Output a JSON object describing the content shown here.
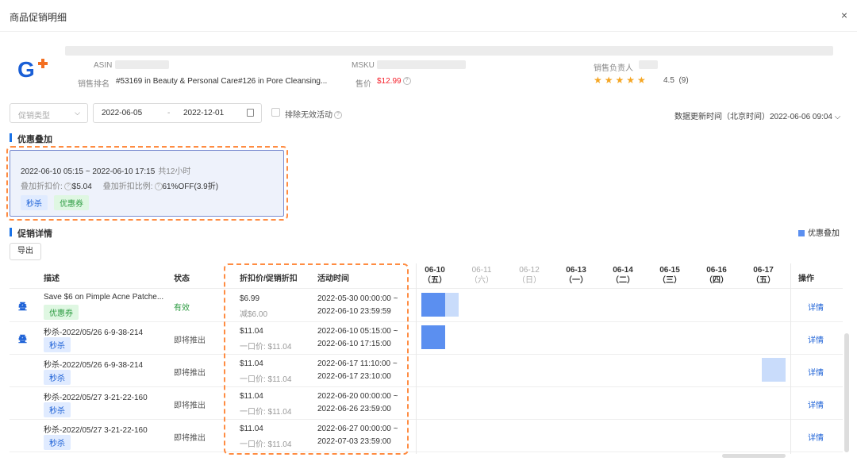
{
  "window": {
    "title": "商品促销明细",
    "close": "×"
  },
  "product": {
    "asin_label": "ASIN",
    "msku_label": "MSKU",
    "owner_label": "销售负责人",
    "rank_label": "销售排名",
    "rank_value": "#53169 in Beauty & Personal Care#126 in Pore Cleansing...",
    "price_label": "售价",
    "price_value": "$12.99",
    "rating_value": "4.5",
    "rating_count": "(9)",
    "stars": "★★★★★",
    "logo_color": "#1a5fd6",
    "logo_accent": "#f36f21"
  },
  "filters": {
    "type_placeholder": "促销类型",
    "date_start": "2022-06-05",
    "date_sep": "-",
    "date_end": "2022-12-01",
    "exclude_label": "排除无效活动",
    "update_text": "数据更新时间（北京时间）2022-06-06 09:04"
  },
  "stack_section": {
    "title": "优惠叠加",
    "time_range": "2022-06-10 05:15 ~ 2022-06-10 17:15",
    "duration": "共12小时",
    "price_label": "叠加折扣价:",
    "price_value": "$5.04",
    "ratio_label": "叠加折扣比例:",
    "ratio_value": "61%OFF(3.9折)",
    "tags": [
      "秒杀",
      "优惠券"
    ]
  },
  "detail_section": {
    "title": "促销详情",
    "legend": "优惠叠加",
    "export_label": "导出",
    "columns": {
      "desc": "描述",
      "status": "状态",
      "price": "折扣价/促销折扣",
      "time": "活动时间",
      "op": "操作"
    },
    "days": [
      {
        "date": "06-10",
        "dow": "（五）"
      },
      {
        "date": "06-11",
        "dow": "（六）"
      },
      {
        "date": "06-12",
        "dow": "（日）"
      },
      {
        "date": "06-13",
        "dow": "（一）"
      },
      {
        "date": "06-14",
        "dow": "（二）"
      },
      {
        "date": "06-15",
        "dow": "（三）"
      },
      {
        "date": "06-16",
        "dow": "（四）"
      },
      {
        "date": "06-17",
        "dow": "（五）"
      }
    ],
    "rows": [
      {
        "flag": "叠",
        "desc": "Save $6 on Pimple Acne Patche...",
        "tag": "优惠券",
        "status": "有效",
        "price": "$6.99",
        "price_sub": "减$6.00",
        "start": "2022-05-30 00:00:00 ~",
        "end": "2022-06-10 23:59:59",
        "op": "详情"
      },
      {
        "flag": "叠",
        "desc": "秒杀-2022/05/26 6-9-38-214",
        "tag": "秒杀",
        "status": "即将推出",
        "price": "$11.04",
        "price_sub": "一口价: $11.04",
        "start": "2022-06-10 05:15:00 ~",
        "end": "2022-06-10 17:15:00",
        "op": "详情"
      },
      {
        "flag": "",
        "desc": "秒杀-2022/05/26 6-9-38-214",
        "tag": "秒杀",
        "status": "即将推出",
        "price": "$11.04",
        "price_sub": "一口价: $11.04",
        "start": "2022-06-17 11:10:00 ~",
        "end": "2022-06-17 23:10:00",
        "op": "详情"
      },
      {
        "flag": "",
        "desc": "秒杀-2022/05/27 3-21-22-160",
        "tag": "秒杀",
        "status": "即将推出",
        "price": "$11.04",
        "price_sub": "一口价: $11.04",
        "start": "2022-06-20 00:00:00 ~",
        "end": "2022-06-26 23:59:00",
        "op": "详情"
      },
      {
        "flag": "",
        "desc": "秒杀-2022/05/27 3-21-22-160",
        "tag": "秒杀",
        "status": "即将推出",
        "price": "$11.04",
        "price_sub": "一口价: $11.04",
        "start": "2022-06-27 00:00:00 ~",
        "end": "2022-07-03 23:59:00",
        "op": "详情"
      }
    ]
  }
}
